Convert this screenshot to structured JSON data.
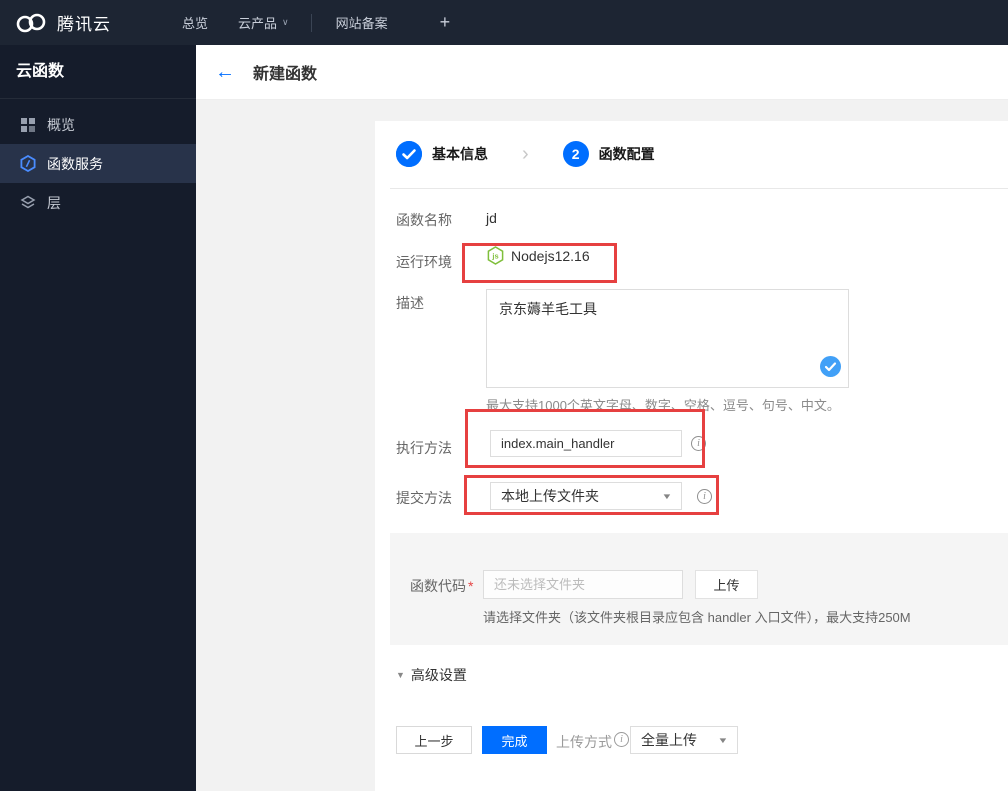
{
  "topnav": {
    "brand": "腾讯云",
    "items": [
      {
        "label": "总览"
      },
      {
        "label": "云产品"
      },
      {
        "label": "网站备案"
      }
    ]
  },
  "sidebar": {
    "title": "云函数",
    "items": [
      {
        "label": "概览",
        "icon": "grid-icon",
        "selected": false
      },
      {
        "label": "函数服务",
        "icon": "scf-hexagon-icon",
        "selected": true
      },
      {
        "label": "层",
        "icon": "layers-icon",
        "selected": false
      }
    ]
  },
  "header": {
    "title": "新建函数"
  },
  "steps": [
    {
      "label": "基本信息",
      "state": "done"
    },
    {
      "label": "函数配置",
      "state": "current",
      "number": "2"
    }
  ],
  "form": {
    "name": {
      "label": "函数名称",
      "value": "jd"
    },
    "runtime": {
      "label": "运行环境",
      "value": "Nodejs12.16",
      "icon": "nodejs-icon"
    },
    "description": {
      "label": "描述",
      "value": "京东薅羊毛工具",
      "hint": "最大支持1000个英文字母、数字、空格、逗号、句号、中文。"
    },
    "handler": {
      "label": "执行方法",
      "value": "index.main_handler"
    },
    "submit_method": {
      "label": "提交方法",
      "value": "本地上传文件夹"
    },
    "code": {
      "label": "函数代码",
      "required": "*",
      "placeholder": "还未选择文件夹",
      "upload_label": "上传",
      "helper": "请选择文件夹（该文件夹根目录应包含 handler 入口文件），最大支持250M"
    },
    "advanced": {
      "label": "高级设置"
    }
  },
  "footer": {
    "prev_label": "上一步",
    "finish_label": "完成",
    "upload_mode_label": "上传方式",
    "upload_mode_value": "全量上传"
  },
  "icons": {
    "back": "←",
    "nav_caret": "∨",
    "step_chevron": "›",
    "select_caret": "▼",
    "advanced_triangle": "▼",
    "plus": "+",
    "info": "i"
  },
  "colors": {
    "accent_blue": "#006eff",
    "check_light_blue": "#41a0f7",
    "annotation_red": "#e64040",
    "nodejs_green": "#7fbf3b",
    "topnav_bg": "#1d2533",
    "sidebar_bg": "#151c2b",
    "sidebar_selected_bg": "#28334a"
  }
}
